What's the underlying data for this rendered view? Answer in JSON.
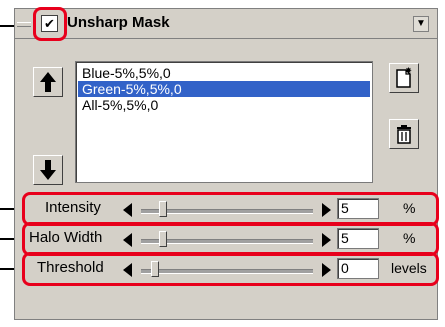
{
  "panel": {
    "title": "Unsharp Mask",
    "enabled": true,
    "check_glyph": "✔",
    "menu_glyph": "▼"
  },
  "presets": {
    "items": [
      {
        "label": "Blue-5%,5%,0",
        "selected": false
      },
      {
        "label": "Green-5%,5%,0",
        "selected": true
      },
      {
        "label": "All-5%,5%,0",
        "selected": false
      }
    ]
  },
  "controls": {
    "intensity": {
      "label": "Intensity",
      "value": "5",
      "unit": "%",
      "level": 0.05
    },
    "halo_width": {
      "label": "Halo Width",
      "value": "5",
      "unit": "%",
      "level": 0.05
    },
    "threshold": {
      "label": "Threshold",
      "value": "0",
      "unit": "levels",
      "level": 0.0
    }
  },
  "icons": {
    "move_up": "arrow-up-icon",
    "move_down": "arrow-down-icon",
    "new": "new-document-icon",
    "delete": "trash-icon"
  },
  "colors": {
    "selection": "#3262c8",
    "highlight": "#e8001c",
    "panel_bg": "#d4d0c8"
  }
}
